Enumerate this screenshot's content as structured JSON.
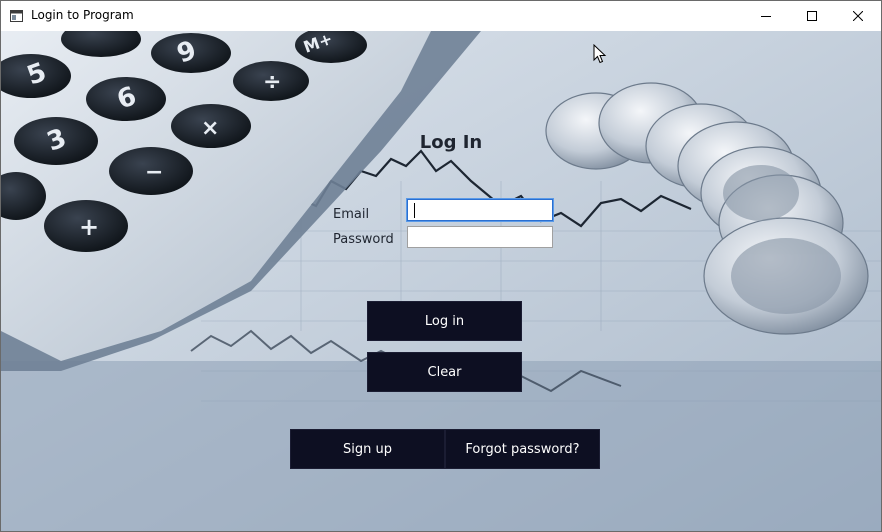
{
  "window": {
    "title": "Login to Program",
    "icons": {
      "app": "app-window-icon",
      "minimize": "minimize-icon",
      "maximize": "maximize-icon",
      "close": "close-icon"
    }
  },
  "form": {
    "title": "Log In",
    "email_label": "Email",
    "email_value": "",
    "password_label": "Password",
    "password_value": "",
    "login_label": "Log in",
    "clear_label": "Clear",
    "signup_label": "Sign up",
    "forgot_label": "Forgot password?"
  },
  "colors": {
    "button_bg": "#0d0f22",
    "button_text": "#ffffff",
    "focus_border": "#2a6fd1"
  }
}
